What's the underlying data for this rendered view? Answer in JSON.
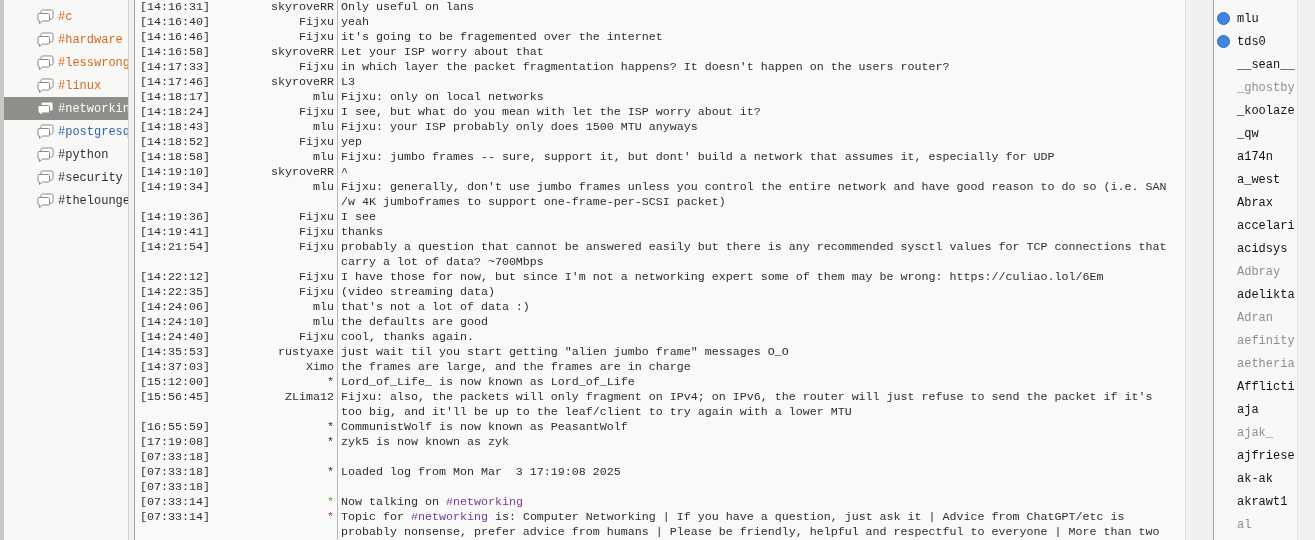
{
  "channels": [
    {
      "label": "#c",
      "new_message": true,
      "new_data": false,
      "selected": false
    },
    {
      "label": "#hardware",
      "new_message": true,
      "new_data": false,
      "selected": false
    },
    {
      "label": "#lesswrong",
      "new_message": true,
      "new_data": false,
      "selected": false
    },
    {
      "label": "#linux",
      "new_message": true,
      "new_data": false,
      "selected": false
    },
    {
      "label": "#networkin",
      "new_message": false,
      "new_data": false,
      "selected": true
    },
    {
      "label": "#postgresq",
      "new_message": false,
      "new_data": true,
      "selected": false
    },
    {
      "label": "#python",
      "new_message": false,
      "new_data": false,
      "selected": false
    },
    {
      "label": "#security",
      "new_message": false,
      "new_data": false,
      "selected": false
    },
    {
      "label": "#thelounge",
      "new_message": false,
      "new_data": false,
      "selected": false
    }
  ],
  "messages": [
    {
      "kind": "chat",
      "time": "[14:16:31]",
      "nick": "skyroveRR",
      "lines": [
        "Only useful on lans"
      ]
    },
    {
      "kind": "chat",
      "time": "[14:16:40]",
      "nick": "Fijxu",
      "lines": [
        "yeah"
      ]
    },
    {
      "kind": "chat",
      "time": "[14:16:46]",
      "nick": "Fijxu",
      "lines": [
        "it's going to be fragemented over the internet"
      ]
    },
    {
      "kind": "chat",
      "time": "[14:16:58]",
      "nick": "skyroveRR",
      "lines": [
        "Let your ISP worry about that"
      ]
    },
    {
      "kind": "chat",
      "time": "[14:17:33]",
      "nick": "Fijxu",
      "lines": [
        "in which layer the packet fragmentation happens? It doesn't happen on the users router?"
      ]
    },
    {
      "kind": "chat",
      "time": "[14:17:46]",
      "nick": "skyroveRR",
      "lines": [
        "L3"
      ]
    },
    {
      "kind": "chat",
      "time": "[14:18:17]",
      "nick": "mlu",
      "lines": [
        "Fijxu: only on local networks"
      ]
    },
    {
      "kind": "chat",
      "time": "[14:18:24]",
      "nick": "Fijxu",
      "lines": [
        "I see, but what do you mean with let the ISP worry about it?"
      ]
    },
    {
      "kind": "chat",
      "time": "[14:18:43]",
      "nick": "mlu",
      "lines": [
        "Fijxu: your ISP probably only does 1500 MTU anyways"
      ]
    },
    {
      "kind": "chat",
      "time": "[14:18:52]",
      "nick": "Fijxu",
      "lines": [
        "yep"
      ]
    },
    {
      "kind": "chat",
      "time": "[14:18:58]",
      "nick": "mlu",
      "lines": [
        "Fijxu: jumbo frames -- sure, support it, but dont' build a network that assumes it, especially for UDP"
      ]
    },
    {
      "kind": "chat",
      "time": "[14:19:10]",
      "nick": "skyroveRR",
      "lines": [
        "^"
      ]
    },
    {
      "kind": "chat",
      "time": "[14:19:34]",
      "nick": "mlu",
      "lines": [
        "Fijxu: generally, don't use jumbo frames unless you control the entire network and have good reason to do so (i.e. SAN",
        "/w 4K jumboframes to support one-frame-per-SCSI packet)"
      ]
    },
    {
      "kind": "chat",
      "time": "[14:19:36]",
      "nick": "Fijxu",
      "lines": [
        "I see"
      ]
    },
    {
      "kind": "chat",
      "time": "[14:19:41]",
      "nick": "Fijxu",
      "lines": [
        "thanks"
      ]
    },
    {
      "kind": "chat",
      "time": "[14:21:54]",
      "nick": "Fijxu",
      "lines": [
        "probably a question that cannot be answered easily but there is any recommended sysctl values for TCP connections that",
        "carry a lot of data? ~700Mbps"
      ]
    },
    {
      "kind": "chat",
      "time": "[14:22:12]",
      "nick": "Fijxu",
      "lines": [
        "I have those for now, but since I'm not a networking expert some of them may be wrong: https://culiao.lol/6Em"
      ]
    },
    {
      "kind": "chat",
      "time": "[14:22:35]",
      "nick": "Fijxu",
      "lines": [
        "(video streaming data)"
      ]
    },
    {
      "kind": "chat",
      "time": "[14:24:06]",
      "nick": "mlu",
      "lines": [
        "that's not a lot of data :)"
      ]
    },
    {
      "kind": "chat",
      "time": "[14:24:10]",
      "nick": "mlu",
      "lines": [
        "the defaults are good"
      ]
    },
    {
      "kind": "chat",
      "time": "[14:24:40]",
      "nick": "Fijxu",
      "lines": [
        "cool, thanks again."
      ]
    },
    {
      "kind": "chat",
      "time": "[14:35:53]",
      "nick": "rustyaxe",
      "lines": [
        "just wait til you start getting \"alien jumbo frame\" messages O_O"
      ]
    },
    {
      "kind": "chat",
      "time": "[14:37:03]",
      "nick": "Ximo",
      "lines": [
        "the frames are large, and the frames are in charge"
      ]
    },
    {
      "kind": "system",
      "time": "[15:12:00]",
      "nick": "*",
      "lines": [
        "Lord_of_Life_ is now known as Lord_of_Life"
      ]
    },
    {
      "kind": "chat",
      "time": "[15:56:45]",
      "nick": "ZLima12",
      "lines": [
        "Fijxu: also, the packets will only fragment on IPv4; on IPv6, the router will just refuse to send the packet if it's",
        "too big, and it'll be up to the leaf/client to try again with a lower MTU"
      ]
    },
    {
      "kind": "system",
      "time": "[16:55:59]",
      "nick": "*",
      "lines": [
        "CommunistWolf is now known as PeasantWolf"
      ]
    },
    {
      "kind": "system",
      "time": "[17:19:08]",
      "nick": "*",
      "lines": [
        "zyk5 is now known as zyk"
      ]
    },
    {
      "kind": "blank",
      "time": "[07:33:18]"
    },
    {
      "kind": "system",
      "time": "[07:33:18]",
      "nick": "*",
      "lines": [
        "Loaded log from Mon Mar  3 17:19:08 2025"
      ]
    },
    {
      "kind": "blank",
      "time": "[07:33:18]"
    },
    {
      "kind": "join",
      "time": "[07:33:14]",
      "nick": "*",
      "lines": [
        [
          {
            "text": "Now talking on ",
            "kind": "plain"
          },
          {
            "text": "#networking",
            "kind": "channel"
          }
        ]
      ]
    },
    {
      "kind": "topic",
      "time": "[07:33:14]",
      "nick": "*",
      "lines": [
        [
          {
            "text": "Topic for ",
            "kind": "plain"
          },
          {
            "text": "#networking",
            "kind": "channel"
          },
          {
            "text": " is: Computer Networking | If you have a question, just ask it | Advice from ChatGPT/etc is",
            "kind": "plain"
          }
        ],
        "probably nonsense, prefer advice from humans | Please be friendly, helpful and respectful to everyone | More than two"
      ]
    }
  ],
  "users": [
    {
      "name": "mlu",
      "op": true,
      "away": false
    },
    {
      "name": "tds0",
      "op": true,
      "away": false
    },
    {
      "name": "__sean__",
      "op": false,
      "away": false
    },
    {
      "name": "_ghostby",
      "op": false,
      "away": true
    },
    {
      "name": "_koolaze",
      "op": false,
      "away": false
    },
    {
      "name": "_qw",
      "op": false,
      "away": false
    },
    {
      "name": "a174n",
      "op": false,
      "away": false
    },
    {
      "name": "a_west",
      "op": false,
      "away": false
    },
    {
      "name": "Abrax",
      "op": false,
      "away": false
    },
    {
      "name": "accelari",
      "op": false,
      "away": false
    },
    {
      "name": "acidsys",
      "op": false,
      "away": false
    },
    {
      "name": "Adbray",
      "op": false,
      "away": true
    },
    {
      "name": "adelikta",
      "op": false,
      "away": false
    },
    {
      "name": "Adran",
      "op": false,
      "away": true
    },
    {
      "name": "aefinity",
      "op": false,
      "away": true
    },
    {
      "name": "aetheria",
      "op": false,
      "away": true
    },
    {
      "name": "Afflicti",
      "op": false,
      "away": false
    },
    {
      "name": "aja",
      "op": false,
      "away": false
    },
    {
      "name": "ajak_",
      "op": false,
      "away": true
    },
    {
      "name": "ajfriese",
      "op": false,
      "away": false
    },
    {
      "name": "ak-ak",
      "op": false,
      "away": false
    },
    {
      "name": "akrawt1",
      "op": false,
      "away": false
    },
    {
      "name": "al",
      "op": false,
      "away": true
    }
  ]
}
